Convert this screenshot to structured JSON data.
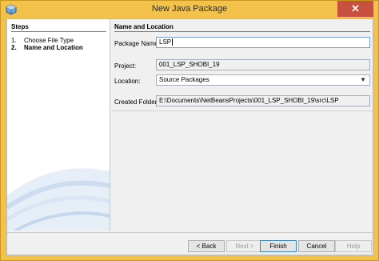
{
  "window": {
    "title": "New Java Package",
    "close_glyph": "✕"
  },
  "steps": {
    "heading": "Steps",
    "items": [
      {
        "number": "1.",
        "label": "Choose File Type",
        "current": false
      },
      {
        "number": "2.",
        "label": "Name and Location",
        "current": true
      }
    ]
  },
  "form": {
    "section_title": "Name and Location",
    "package_name": {
      "label": "Package Name:",
      "value": "LSP"
    },
    "project": {
      "label": "Project:",
      "value": "001_LSP_SHOBI_19"
    },
    "location": {
      "label": "Location:",
      "value": "Source Packages"
    },
    "created_folder": {
      "label": "Created Folder:",
      "value": "E:\\Documents\\NetBeansProjects\\001_LSP_SHOBI_19\\src\\LSP"
    }
  },
  "buttons": {
    "back": "< Back",
    "next": "Next >",
    "finish": "Finish",
    "cancel": "Cancel",
    "help": "Help"
  }
}
